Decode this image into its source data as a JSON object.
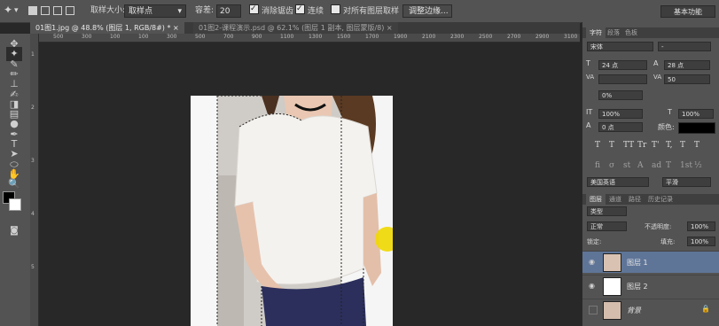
{
  "options_bar": {
    "sample_size_label": "取样大小:",
    "sample_size_value": "取样点",
    "tolerance_label": "容差:",
    "tolerance_value": "20",
    "antialias_label": "消除锯齿",
    "antialias_checked": true,
    "contiguous_label": "连续",
    "contiguous_checked": true,
    "all_layers_label": "对所有图层取样",
    "all_layers_checked": false,
    "refine_edge_label": "调整边缘...",
    "workspace_label": "基本功能"
  },
  "document_tabs": [
    {
      "label": "01图1.jpg @ 48.8% (图层 1, RGB/8#) *",
      "close": "×",
      "active": true
    },
    {
      "label": "01图2-课程演示.psd @ 62.1% (图层 1 副本, 图层蒙版/8)",
      "close": "×",
      "active": false
    }
  ],
  "ruler": {
    "h_ticks": [
      "500",
      "300",
      "100",
      "100",
      "300",
      "500",
      "700",
      "900",
      "1100",
      "1300",
      "1500",
      "1700",
      "1900",
      "2100",
      "2300",
      "2500",
      "2700",
      "2900",
      "3100"
    ],
    "v_ticks": [
      "1",
      "2",
      "3",
      "4",
      "5"
    ]
  },
  "tools": [
    {
      "icon": "move-icon",
      "glyph": "✥"
    },
    {
      "icon": "magic-wand-icon",
      "glyph": "✦",
      "active": true
    },
    {
      "icon": "eyedropper-icon",
      "glyph": "✎"
    },
    {
      "icon": "brush-icon",
      "glyph": "✏"
    },
    {
      "icon": "stamp-icon",
      "glyph": "⊥"
    },
    {
      "icon": "history-brush-icon",
      "glyph": "✍"
    },
    {
      "icon": "eraser-icon",
      "glyph": "◨"
    },
    {
      "icon": "gradient-icon",
      "glyph": "▤"
    },
    {
      "icon": "dodge-icon",
      "glyph": "●"
    },
    {
      "icon": "pen-icon",
      "glyph": "✒"
    },
    {
      "icon": "type-icon",
      "glyph": "T"
    },
    {
      "icon": "path-select-icon",
      "glyph": "➤"
    },
    {
      "icon": "shape-icon",
      "glyph": "⬭"
    },
    {
      "icon": "hand-icon",
      "glyph": "✋"
    },
    {
      "icon": "zoom-icon",
      "glyph": "🔍"
    }
  ],
  "colors": {
    "foreground": "#000000",
    "background": "#ffffff",
    "selected_layer": "#5f7598",
    "panel_bg": "#535353",
    "highlight": "#f0d800"
  },
  "character_panel": {
    "tabs": [
      "字符",
      "段落",
      "色板"
    ],
    "font_family": "宋体",
    "font_style": "-",
    "font_size": "24 点",
    "leading": "28 点",
    "kerning": "",
    "tracking": "50",
    "scale_pct": "0%",
    "vert_scale": "100%",
    "horiz_scale": "100%",
    "baseline": "0 点",
    "color_label": "颜色:",
    "style_buttons": [
      "T",
      "T",
      "TT",
      "Tr",
      "T'",
      "T,",
      "T",
      "T"
    ],
    "opentype_buttons": [
      "fi",
      "σ",
      "st",
      "A",
      "ad",
      "T",
      "1st",
      "½"
    ],
    "language": "美国英语",
    "antialias_mode": "平滑"
  },
  "layers_panel": {
    "tabs": [
      "图层",
      "通道",
      "路径",
      "历史记录"
    ],
    "filter_label": "类型",
    "blend_mode": "正常",
    "opacity_label": "不透明度:",
    "opacity_value": "100%",
    "lock_label": "锁定:",
    "fill_label": "填充:",
    "fill_value": "100%",
    "layers": [
      {
        "name": "图层 1",
        "selected": true,
        "visible": true,
        "thumb": "photo"
      },
      {
        "name": "图层 2",
        "selected": false,
        "visible": true,
        "thumb": "white"
      },
      {
        "name": "背景",
        "selected": false,
        "visible": false,
        "thumb": "photo",
        "locked": true
      }
    ]
  }
}
